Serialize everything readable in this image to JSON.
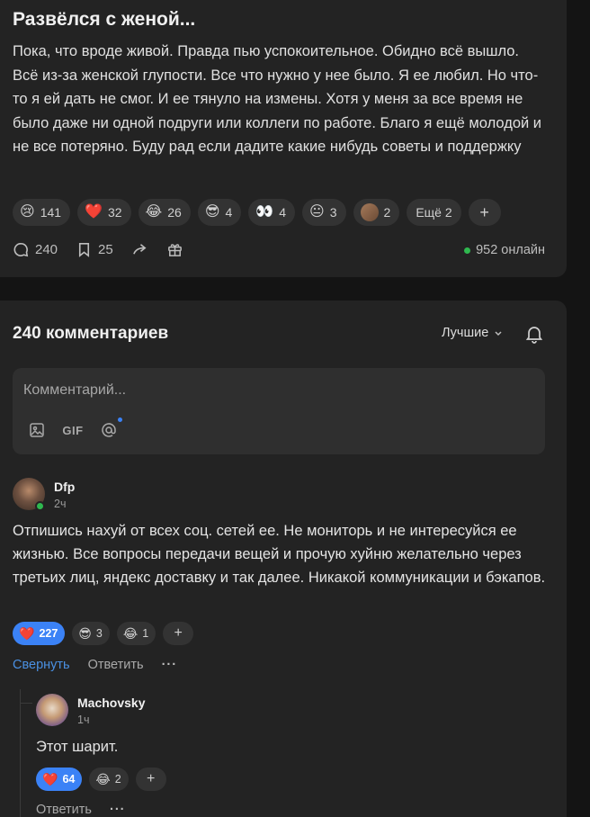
{
  "post": {
    "title": "Развёлся с женой...",
    "text": "Пока, что вроде живой. Правда пью успокоительное. Обидно всё вышло. Всё из-за женской глупости. Все что нужно у нее было. Я ее любил. Но что-то я ей дать не смог. И ее тянуло на измены. Хотя у меня за все время не было даже ни одной подруги или коллеги по работе. Благо я ещё молодой и не все потеряно. Буду рад если дадите какие нибудь советы и поддержку",
    "reactions": [
      {
        "icon": "crying-face-icon",
        "glyph": "😢",
        "count": "141"
      },
      {
        "icon": "heart-icon",
        "glyph": "❤️",
        "count": "32"
      },
      {
        "icon": "tears-of-joy-icon",
        "glyph": "😂",
        "count": "26"
      },
      {
        "icon": "sunglasses-face-icon",
        "glyph": "😎",
        "count": "4"
      },
      {
        "icon": "eyes-icon",
        "glyph": "👀",
        "count": "4"
      },
      {
        "icon": "neutral-face-icon",
        "glyph": "😐",
        "count": "3"
      },
      {
        "icon": "custom-avatar-reaction-icon",
        "glyph": "",
        "count": "2"
      }
    ],
    "more_reactions": "Ещё 2",
    "add_reaction": "+",
    "comments_count": "240",
    "bookmarks_count": "25",
    "online": "952 онлайн"
  },
  "comments_section": {
    "title": "240 комментариев",
    "sort_label": "Лучшие",
    "editor_placeholder": "Комментарий...",
    "gif_label": "GIF"
  },
  "comments": [
    {
      "author": "Dfp",
      "time": "2ч",
      "text": "Отпишись нахуй от всех соц. сетей ее. Не мониторь и не интересуйся ее жизнью. Все вопросы передачи вещей и прочую хуйню желательно через третьих лиц, яндекс доставку и так далее. Никакой коммуникации и бэкапов.",
      "reactions": [
        {
          "icon": "heart-icon",
          "glyph": "❤️",
          "count": "227",
          "active": true
        },
        {
          "icon": "sunglasses-face-icon",
          "glyph": "😎",
          "count": "3"
        },
        {
          "icon": "tears-of-joy-icon",
          "glyph": "😂",
          "count": "1"
        }
      ],
      "collapse_label": "Свернуть",
      "reply_label": "Ответить",
      "more_label": "···"
    },
    {
      "author": "Machovsky",
      "time": "1ч",
      "text": "Этот шарит.",
      "reactions": [
        {
          "icon": "heart-icon",
          "glyph": "❤️",
          "count": "64",
          "active": true
        },
        {
          "icon": "tears-of-joy-icon",
          "glyph": "😂",
          "count": "2"
        }
      ],
      "reply_label": "Ответить",
      "more_label": "···"
    }
  ],
  "colors": {
    "background": "#141414",
    "card": "#232323",
    "chip": "#333333",
    "accent": "#3b82f6",
    "link": "#4a90e2",
    "online": "#2fb84f"
  }
}
